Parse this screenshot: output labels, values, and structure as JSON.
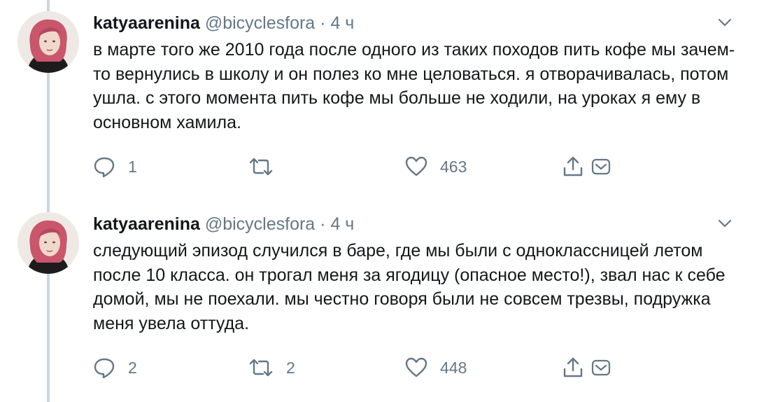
{
  "tweets": [
    {
      "author_name": "katyaarenina",
      "author_handle": "@bicyclesfora",
      "separator": "·",
      "time": "4 ч",
      "text": "в марте того же 2010 года после одного из таких походов пить кофе мы зачем-то вернулись в школу и он полез ко мне целоваться. я отворачивалась, потом ушла. с этого момента пить кофе мы больше не ходили, на уроках я ему в основном хамила.",
      "replies": "1",
      "retweets": "",
      "likes": "463",
      "icons": {
        "reply": "reply-icon",
        "retweet": "retweet-icon",
        "like": "heart-icon",
        "share": "share-icon",
        "dm": "direct-message-icon",
        "menu": "chevron-down-icon"
      }
    },
    {
      "author_name": "katyaarenina",
      "author_handle": "@bicyclesfora",
      "separator": "·",
      "time": "4 ч",
      "text": "следующий эпизод случился в баре, где мы были с одноклассницей летом после 10 класса. он трогал меня за ягодицу (опасное место!), звал нас к себе домой, мы не поехали. мы честно говоря были не совсем трезвы, подружка меня увела оттуда.",
      "replies": "2",
      "retweets": "2",
      "likes": "448",
      "icons": {
        "reply": "reply-icon",
        "retweet": "retweet-icon",
        "like": "heart-icon",
        "share": "share-icon",
        "dm": "direct-message-icon",
        "menu": "chevron-down-icon"
      }
    }
  ],
  "colors": {
    "text": "#14171a",
    "secondary": "#657786",
    "thread_line": "#ccd6dd",
    "avatar_hair": "#c9566b",
    "avatar_skin": "#f1d8cc",
    "avatar_shirt": "#1d1b1c"
  }
}
